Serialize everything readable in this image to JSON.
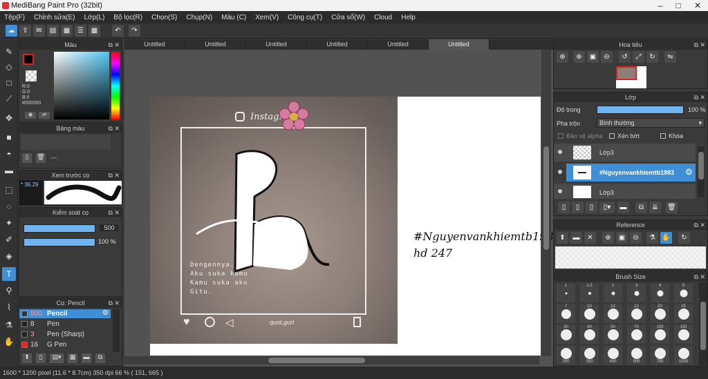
{
  "window": {
    "title": "MediBang Paint Pro (32bit)"
  },
  "menu": [
    "Tệp(F)",
    "Chỉnh sửa(E)",
    "Lớp(L)",
    "Bộ lọc(R)",
    "Chọn(S)",
    "Chụp(N)",
    "Màu (C)",
    "Xem(V)",
    "Công cụ(T)",
    "Cửa sổ(W)",
    "Cloud",
    "Help"
  ],
  "tabs": [
    "Untitled",
    "Untitled",
    "Untitled",
    "Untitled",
    "Untitled",
    "Untitled"
  ],
  "color_panel": {
    "title": "Màu",
    "r": "R:0",
    "g": "G:0",
    "b": "B:0",
    "hex": "#000000"
  },
  "palette_panel": {
    "title": "Bảng màu",
    "dash": "---"
  },
  "preview_panel": {
    "title": "Xem trước cọ",
    "size": "36.29"
  },
  "control_panel": {
    "title": "Kiểm soát cọ",
    "size": "500",
    "opacity": "100 %"
  },
  "brush_panel": {
    "title": "Cọ: Pencil",
    "items": [
      {
        "size": "500",
        "name": "Pencil",
        "selected": true
      },
      {
        "size": "8",
        "name": "Pen",
        "selected": false
      },
      {
        "size": "3",
        "name": "Pen (Sharp)",
        "selected": false
      },
      {
        "size": "16",
        "name": "G Pen",
        "selected": false
      }
    ]
  },
  "canvas": {
    "instagram": "Instagram",
    "letter": "h",
    "poem": [
      "Dengennya. . . .",
      "Aku suka kamu",
      "Kamu suka aku",
      "Gitu."
    ],
    "handle": "quot.gurl",
    "tag": "#Nguyenvankhiemtb1983",
    "tag2": "hd 247"
  },
  "navigator_panel": {
    "title": "Hoa tiêu"
  },
  "layer_panel": {
    "title": "Lớp",
    "opacity_label": "Độ trong",
    "opacity_value": "100 %",
    "blend_label": "Pha trộn",
    "blend_value": "Bình thường",
    "protect_alpha": "Bảo vệ alpha",
    "clip": "Xén bớt",
    "lock": "Khóa",
    "layers": [
      {
        "name": "Lớp3",
        "selected": false
      },
      {
        "name": "#Nguyenvankhiemtb1983",
        "selected": true
      },
      {
        "name": "Lớp3",
        "selected": false
      }
    ]
  },
  "reference_panel": {
    "title": "Reference"
  },
  "brushsize_panel": {
    "title": "Brush Size",
    "labels": [
      "1",
      "1.5",
      "2",
      "3",
      "4",
      "5",
      "7",
      "10",
      "12",
      "15",
      "20",
      "25",
      "30",
      "40",
      "50",
      "70",
      "100",
      "150",
      "200",
      "300",
      "400",
      "500",
      "700",
      "1000"
    ]
  },
  "status": {
    "text": "1600 * 1200 pixel  (11.6 * 8.7cm)  350 dpi  66 %  ( 151, 665 )"
  },
  "colors": {
    "accent": "#3e8fd6"
  }
}
